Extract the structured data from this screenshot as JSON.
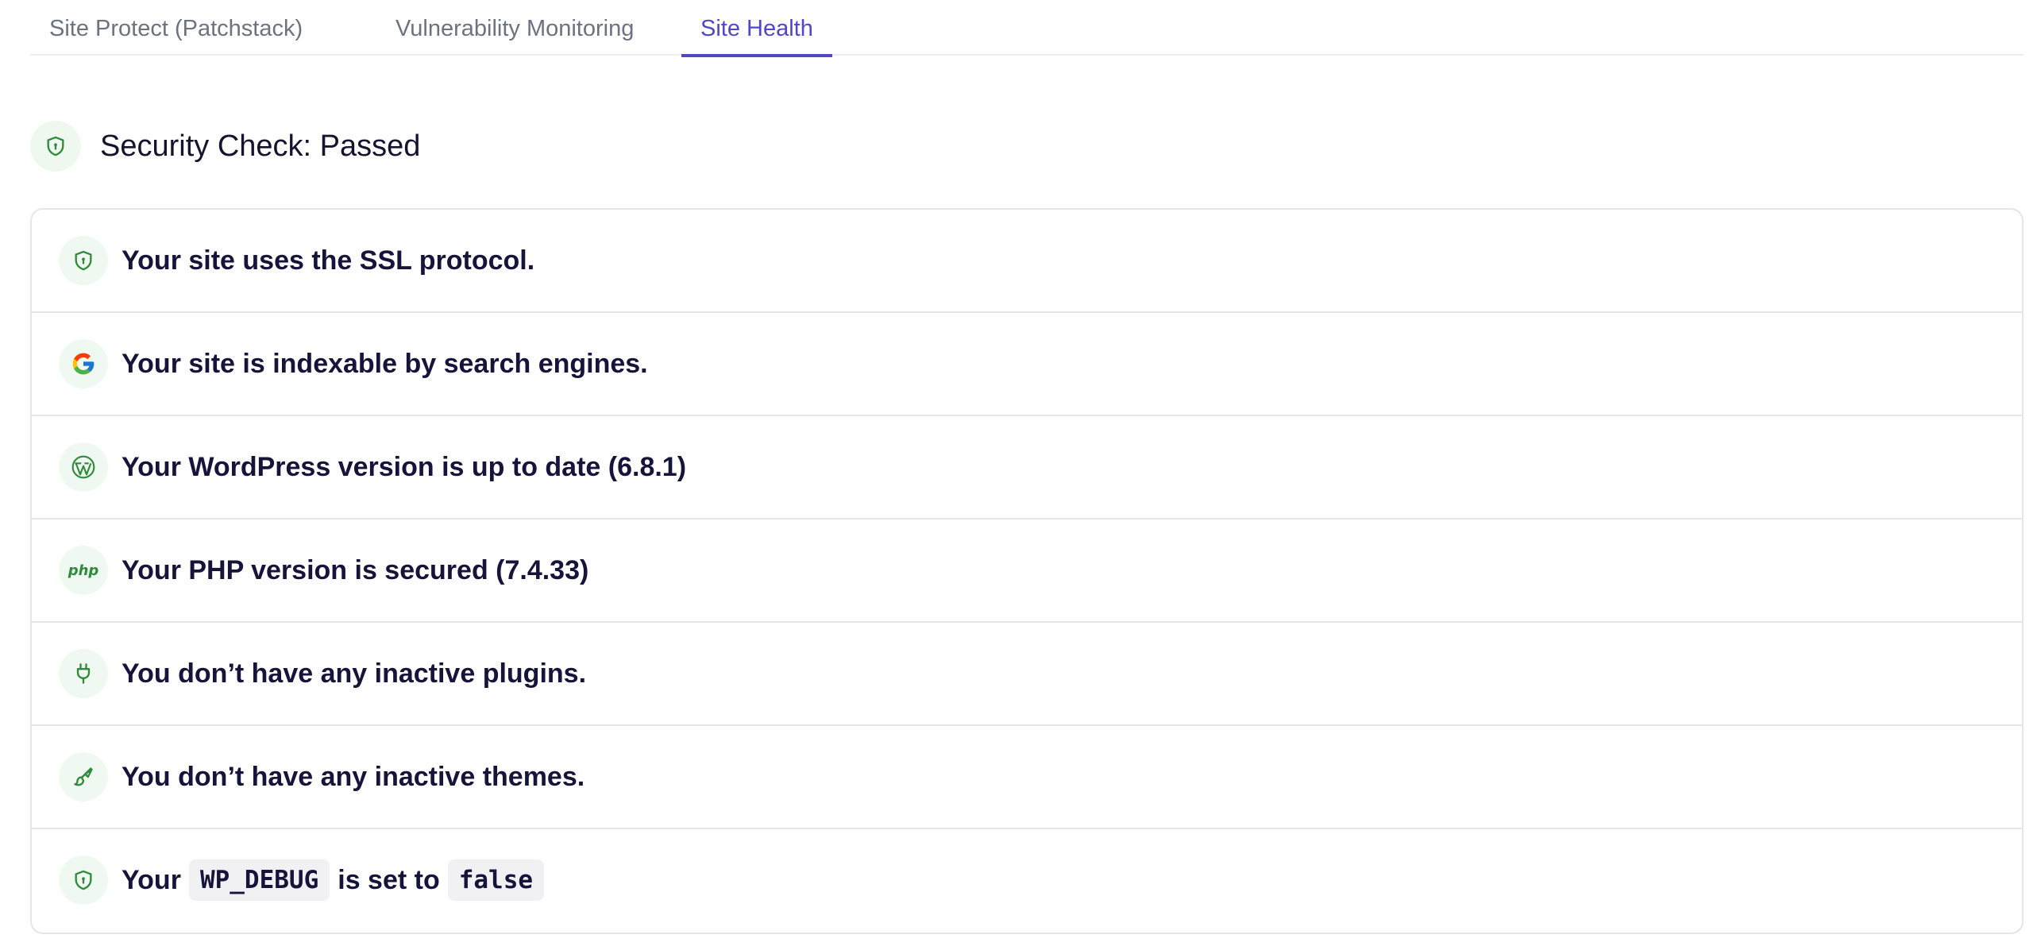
{
  "tabs": [
    {
      "label": "Site Protect (Patchstack)",
      "active": false
    },
    {
      "label": "Vulnerability Monitoring",
      "active": false
    },
    {
      "label": "Site Health",
      "active": true
    }
  ],
  "header": {
    "title": "Security Check: Passed",
    "icon": "shield-icon"
  },
  "colors": {
    "accent": "#4f46c9",
    "success": "#2f8a3a",
    "icon_bg": "#f0f9f1"
  },
  "checks": [
    {
      "icon": "shield-icon",
      "text": "Your site uses the SSL protocol."
    },
    {
      "icon": "google-icon",
      "text": "Your site is indexable by search engines."
    },
    {
      "icon": "wordpress-icon",
      "text": "Your WordPress version is up to date (6.8.1)"
    },
    {
      "icon": "php-icon",
      "icon_text": "php",
      "text": "Your PHP version is secured (7.4.33)"
    },
    {
      "icon": "plug-icon",
      "text": "You don’t have any inactive plugins."
    },
    {
      "icon": "brush-icon",
      "text": "You don’t have any inactive themes."
    },
    {
      "icon": "shield-icon",
      "text_prefix": "Your",
      "code1": "WP_DEBUG",
      "text_middle": "is set to",
      "code2": "false"
    }
  ]
}
